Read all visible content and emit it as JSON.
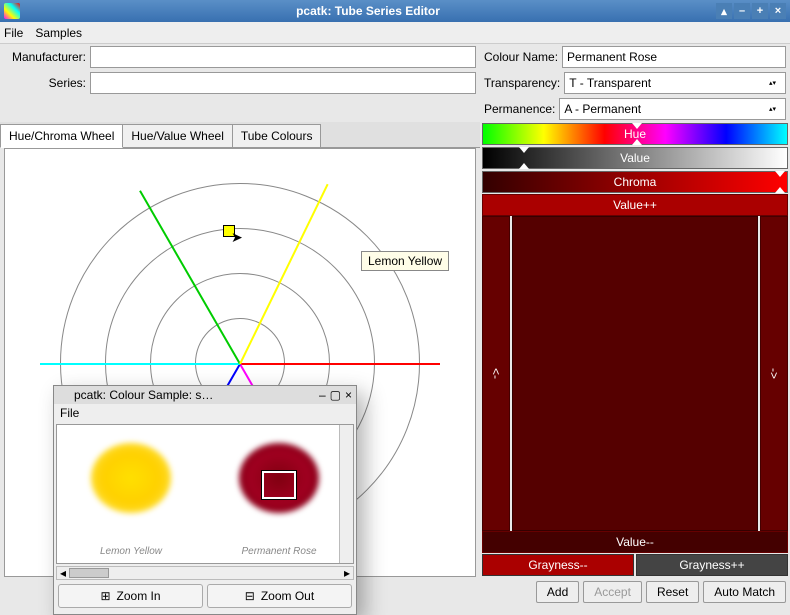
{
  "window": {
    "title": "pcatk: Tube Series Editor"
  },
  "menu": {
    "file": "File",
    "samples": "Samples"
  },
  "form": {
    "manufacturer_label": "Manufacturer:",
    "manufacturer_value": "",
    "series_label": "Series:",
    "series_value": "",
    "colour_name_label": "Colour Name:",
    "colour_name_value": "Permanent Rose",
    "transparency_label": "Transparency:",
    "transparency_value": "T     - Transparent",
    "permanence_label": "Permanence:",
    "permanence_value": "A     - Permanent"
  },
  "tabs": {
    "hue_chroma": "Hue/Chroma Wheel",
    "hue_value": "Hue/Value Wheel",
    "tube_colours": "Tube Colours"
  },
  "tooltip": "Lemon Yellow",
  "sliders": {
    "hue": "Hue",
    "value": "Value",
    "chroma": "Chroma",
    "value_plus": "Value++",
    "value_minus": "Value--",
    "gray_minus": "Grayness--",
    "gray_plus": "Grayness++",
    "left": "<-",
    "right": "->"
  },
  "buttons": {
    "add": "Add",
    "accept": "Accept",
    "reset": "Reset",
    "auto_match": "Auto Match"
  },
  "child": {
    "title": "pcatk: Colour Sample: s…",
    "menu_file": "File",
    "label1": "Lemon Yellow",
    "label2": "Permanent Rose",
    "zoom_in": "Zoom In",
    "zoom_out": "Zoom Out"
  }
}
